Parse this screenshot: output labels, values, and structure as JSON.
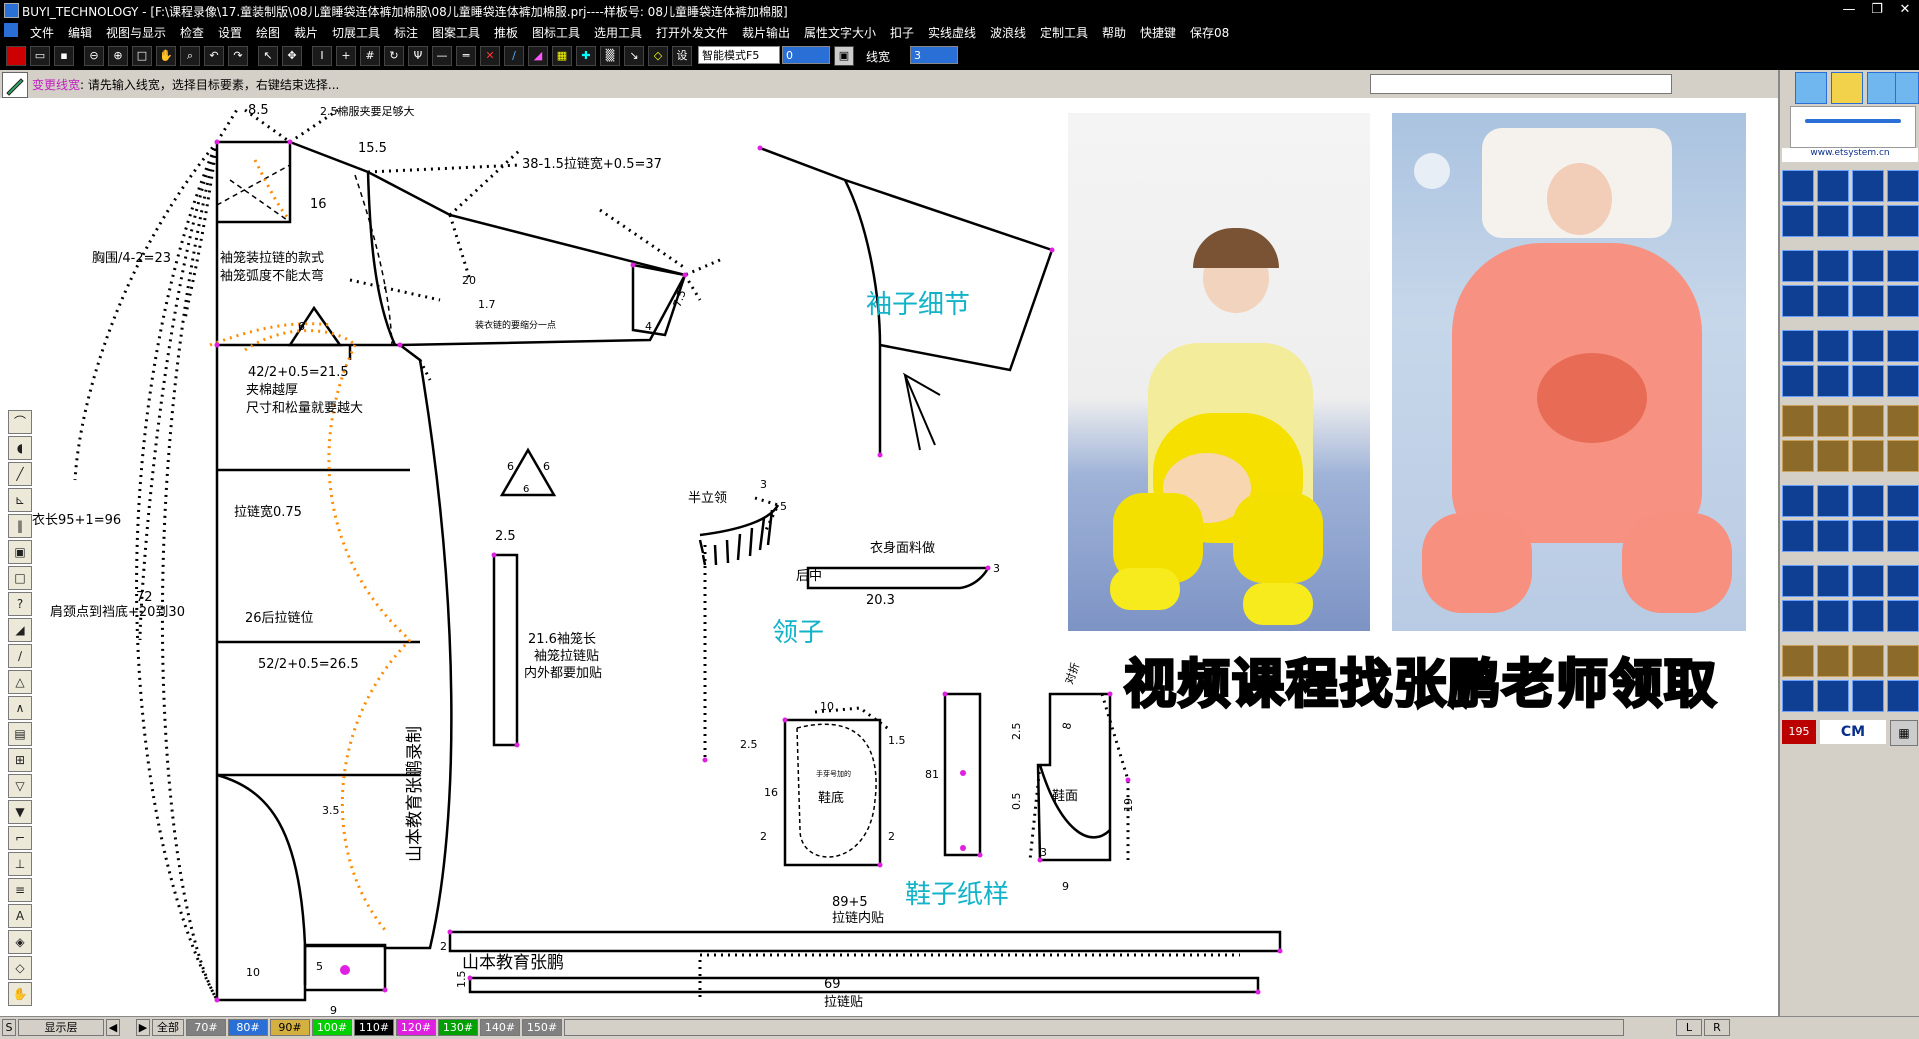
{
  "window": {
    "app": "BUYI_TECHNOLOGY",
    "title": "BUYI_TECHNOLOGY - [F:\\课程录像\\17.童装制版\\08儿童睡袋连体裤加棉服\\08儿童睡袋连体裤加棉服.prj----样板号: 08儿童睡袋连体裤加棉服]",
    "controls": [
      "—",
      "❐",
      "✕"
    ]
  },
  "menu": [
    "文件",
    "编辑",
    "视图与显示",
    "检查",
    "设置",
    "绘图",
    "裁片",
    "切展工具",
    "标注",
    "图案工具",
    "推板",
    "图标工具",
    "选用工具",
    "打开外发文件",
    "裁片输出",
    "属性文字大小",
    "扣子",
    "实线虚线",
    "波浪线",
    "定制工具",
    "帮助",
    "快捷键",
    "保存08"
  ],
  "toolbar": {
    "mode_select": "智能模式F5",
    "num_input": "0",
    "linewidth_label": "线宽",
    "linewidth_value": "3"
  },
  "prompt": {
    "command": "变更线宽",
    "message": ": 请先输入线宽，选择目标要素，右键结束选择..."
  },
  "canvas": {
    "labels": {
      "top_85": "8.5",
      "note_collar": "2.5棉服夹要足够大",
      "shoulder": "15.5",
      "sleeve_len": "38-1.5拉链宽+0.5=37",
      "n16": "16",
      "chest_quarter": "胸围/4-2=23",
      "sleeve_note1": "袖笼装拉链的款式",
      "sleeve_note2": "袖笼弧度不能太弯",
      "n20": "20",
      "n17": "1.7",
      "cuff_note": "装衣链的要缩分一点",
      "n75": "7.5",
      "n4": "4",
      "n6": "6",
      "n42": "42/2+0.5=21.5",
      "thick1": "夹棉越厚",
      "thick2": "尺寸和松量就要越大",
      "body_len": "衣长95+1=96",
      "zip_width": "拉链宽0.75",
      "n72": "72",
      "shoulder_hem": "肩颈点到裆底+20到30",
      "back_zip": "26后拉链位",
      "n52": "52/2+0.5=26.5",
      "n35": "3.5",
      "vertical_credit": "山本教育张鹏录制",
      "n10": "10",
      "n5": "5",
      "n9": "9",
      "tri6a": "6",
      "tri6b": "6",
      "tri6c": "6",
      "n25": "2.5",
      "zipper_piece1": "21.6袖笼长",
      "zipper_piece2": "袖笼拉链贴",
      "zipper_piece3": "内外都要加贴",
      "collar_title": "半立领",
      "collar_3": "3",
      "collar_5": "5",
      "facing_title": "衣身面料做",
      "facing_bc": "后中",
      "facing_3": "3",
      "facing_len": "20.3",
      "shoe_10": "10",
      "shoe_25": "2.5",
      "shoe_15": "1.5",
      "shoe_16": "16",
      "shoe_sole": "鞋底",
      "shoe_2a": "2",
      "shoe_2b": "2",
      "shoe_inner": "手芽号加的",
      "n81": "81",
      "upper_25": "2.5",
      "upper_8": "8",
      "upper_heel": "鞋面",
      "upper_05": "0.5",
      "upper_19": "19",
      "upper_3": "3",
      "upper_9": "9",
      "upper_top": "对折",
      "zip_inner_dim": "89+5",
      "zip_inner": "拉链内贴",
      "credit2": "山本教育张鹏",
      "zip_69": "69",
      "zip_strip": "拉链贴",
      "n15b": "1.5",
      "n2b": "2"
    },
    "cyan_labels": {
      "sleeve_detail": "袖子细节",
      "collar": "领子",
      "shoe_pattern": "鞋子纸样"
    },
    "watermark": "视频课程找张鹏老师领取"
  },
  "right_panel": {
    "website": "www.etsystem.cn",
    "counter": "195",
    "unit": "CM"
  },
  "status": {
    "s_label": "S",
    "layer": "显示层",
    "all": "全部",
    "sizes": [
      "70#",
      "80#",
      "90#",
      "100#",
      "110#",
      "120#",
      "130#",
      "140#",
      "150#"
    ],
    "size_colors": [
      "#808080",
      "#2a6fd6",
      "#d4b040",
      "#00d000",
      "#000000",
      "#e020e0",
      "#00a000",
      "#808080",
      "#808080"
    ],
    "L": "L",
    "R": "R"
  }
}
